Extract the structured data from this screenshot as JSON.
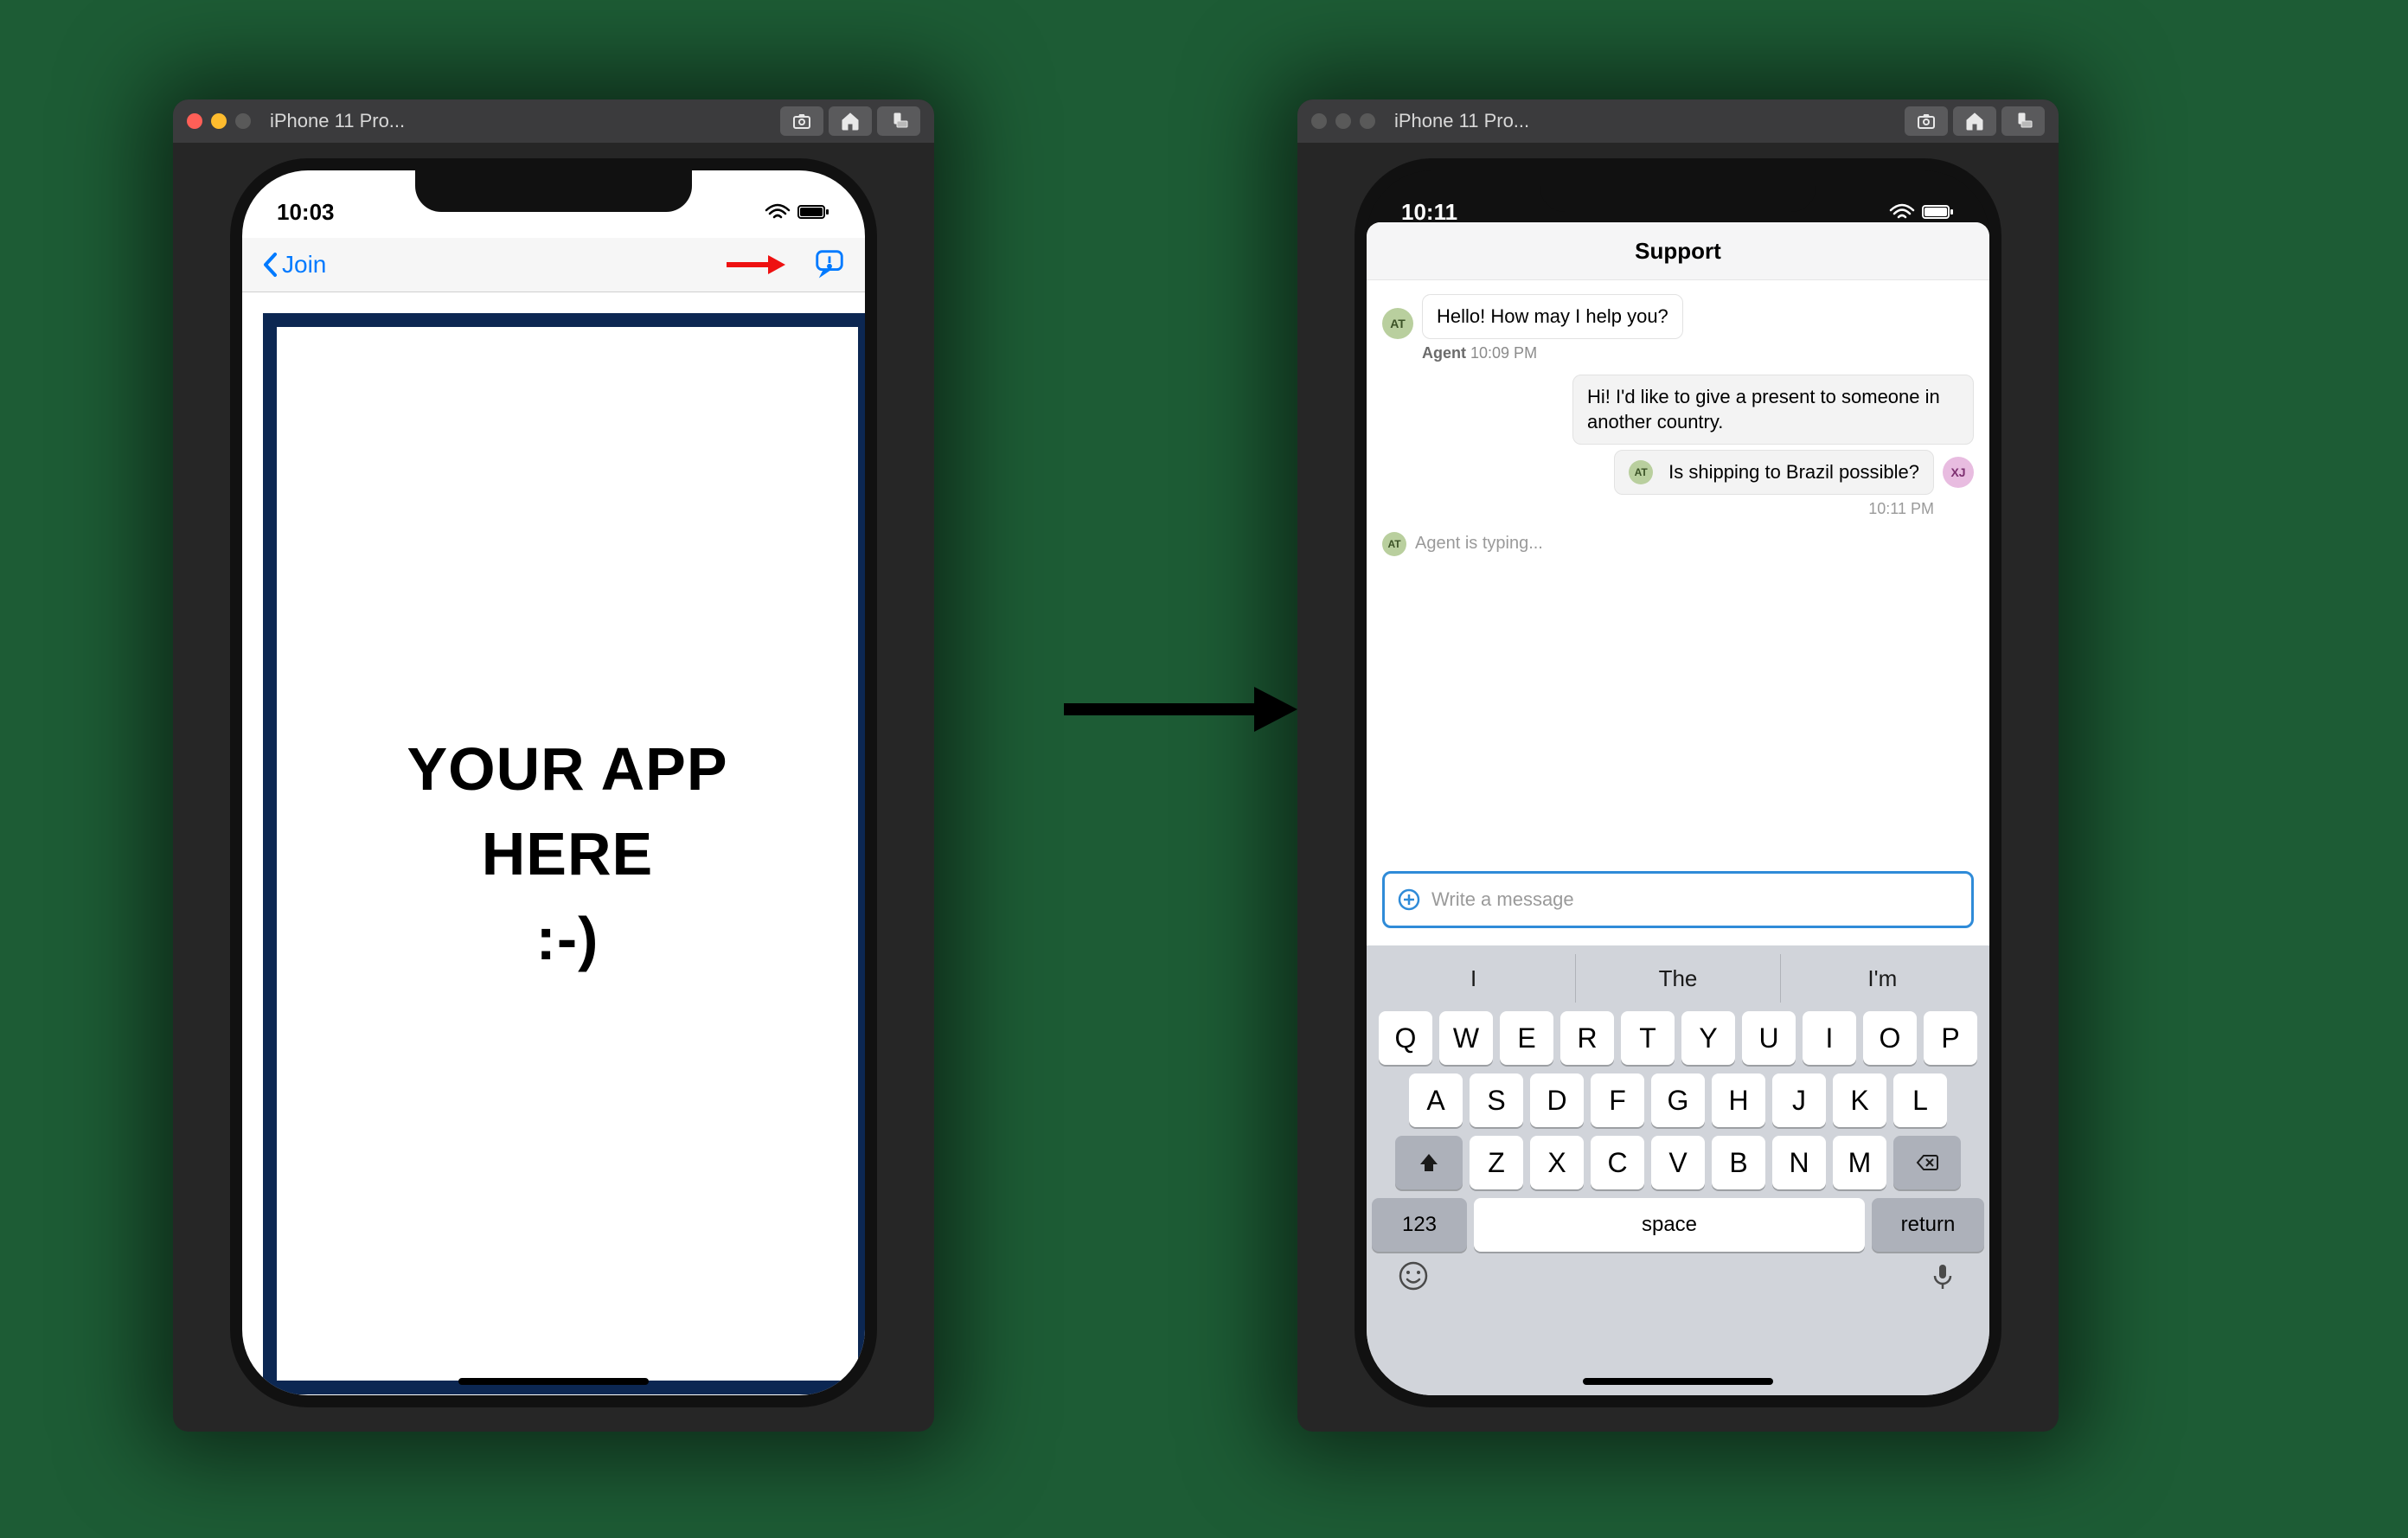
{
  "left": {
    "titlebar": {
      "title": "iPhone 11 Pro..."
    },
    "status": {
      "time": "10:03"
    },
    "nav": {
      "back_label": "Join"
    },
    "placeholder": {
      "line1": "YOUR APP",
      "line2": "HERE",
      "line3": ":-)"
    }
  },
  "right": {
    "titlebar": {
      "title": "iPhone 11 Pro..."
    },
    "status": {
      "time": "10:11"
    },
    "header": {
      "title": "Support"
    },
    "chat": {
      "agent_initials": "AT",
      "user_initials": "XJ",
      "agent_name": "Agent",
      "agent_time": "10:09 PM",
      "agent_msg1": "Hello! How may I help you?",
      "user_msg1": "Hi! I'd like to give a present to someone in another country.",
      "user_msg2": "Is shipping to Brazil possible?",
      "user_time": "10:11 PM",
      "typing": "Agent is typing..."
    },
    "composer": {
      "placeholder": "Write a message"
    },
    "keyboard": {
      "suggestions": [
        "I",
        "The",
        "I'm"
      ],
      "row1": [
        "Q",
        "W",
        "E",
        "R",
        "T",
        "Y",
        "U",
        "I",
        "O",
        "P"
      ],
      "row2": [
        "A",
        "S",
        "D",
        "F",
        "G",
        "H",
        "J",
        "K",
        "L"
      ],
      "row3": [
        "Z",
        "X",
        "C",
        "V",
        "B",
        "N",
        "M"
      ],
      "numkey": "123",
      "space": "space",
      "ret": "return"
    }
  }
}
